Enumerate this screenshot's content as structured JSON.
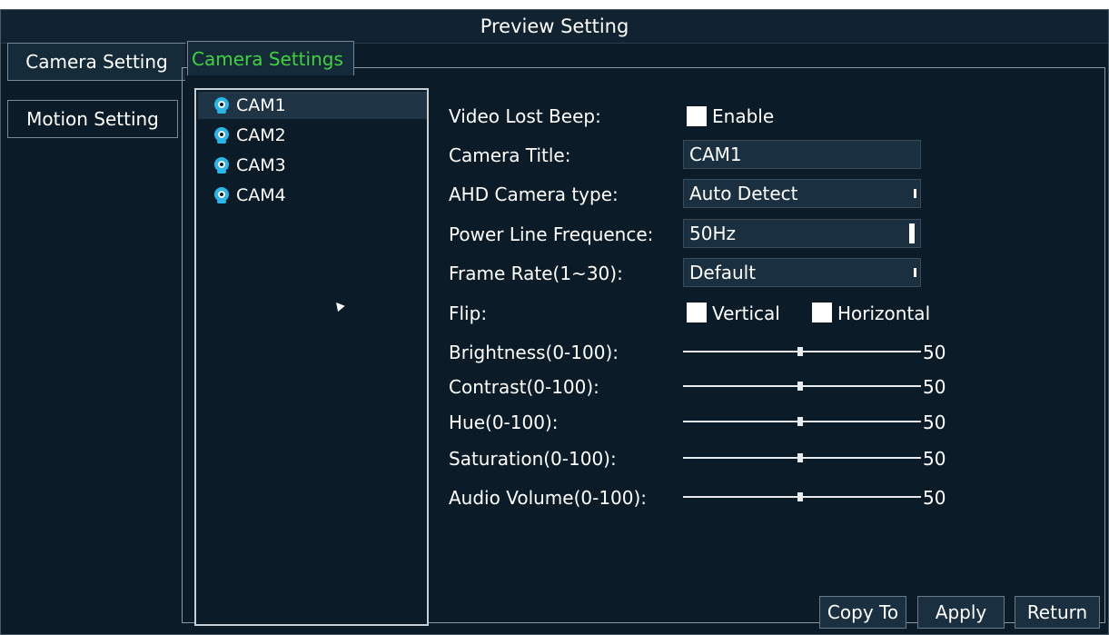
{
  "title": "Preview Setting",
  "left_tabs": [
    "Camera Setting",
    "Motion Setting"
  ],
  "sub_tab": "Camera Settings",
  "cameras": [
    "CAM1",
    "CAM2",
    "CAM3",
    "CAM4"
  ],
  "settings": {
    "video_lost_beep": {
      "label": "Video Lost Beep:",
      "option": "Enable",
      "checked": false
    },
    "camera_title": {
      "label": "Camera Title:",
      "value": "CAM1"
    },
    "ahd_camera_type": {
      "label": "AHD Camera type:",
      "value": "Auto Detect"
    },
    "power_line_frequence": {
      "label": "Power Line Frequence:",
      "value": "50Hz"
    },
    "frame_rate": {
      "label": "Frame Rate(1~30):",
      "value": "Default"
    },
    "flip": {
      "label": "Flip:",
      "vertical": "Vertical",
      "horizontal": "Horizontal"
    },
    "sliders": [
      {
        "label": "Brightness(0-100):",
        "value": "50"
      },
      {
        "label": "Contrast(0-100):",
        "value": "50"
      },
      {
        "label": "Hue(0-100):",
        "value": "50"
      },
      {
        "label": "Saturation(0-100):",
        "value": "50"
      },
      {
        "label": "Audio Volume(0-100):",
        "value": "50"
      }
    ]
  },
  "buttons": {
    "copy_to": "Copy To",
    "apply": "Apply",
    "return": "Return"
  },
  "colors": {
    "background": "#0b1c28",
    "active_tab_text": "#3fd23f",
    "camera_icon": "#29b6e8"
  }
}
